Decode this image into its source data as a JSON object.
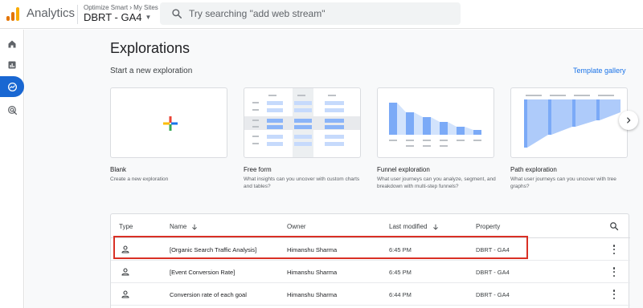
{
  "header": {
    "app_title": "Analytics",
    "breadcrumb": [
      "Optimize Smart",
      "My Sites"
    ],
    "breadcrumb_sep": "›",
    "property_name": "DBRT - GA4",
    "search_placeholder": "Try searching \"add web stream\""
  },
  "nav": {
    "items": [
      {
        "icon": "home-icon"
      },
      {
        "icon": "reports-icon"
      },
      {
        "icon": "explore-icon",
        "active": true
      },
      {
        "icon": "advertising-icon"
      }
    ],
    "accent_color": "#1967d2"
  },
  "main": {
    "title": "Explorations",
    "section_title": "Start a new exploration",
    "template_link": "Template gallery",
    "cards": [
      {
        "title": "Blank",
        "desc": "Create a new exploration",
        "icon": "plus-icon"
      },
      {
        "title": "Free form",
        "desc": "What insights can you uncover with custom charts and tables?"
      },
      {
        "title": "Funnel exploration",
        "desc": "What user journeys can you analyze, segment, and breakdown with multi-step funnels?"
      },
      {
        "title": "Path exploration",
        "desc": "What user journeys can you uncover with tree graphs?"
      }
    ]
  },
  "table": {
    "columns": {
      "type": "Type",
      "name": "Name",
      "owner": "Owner",
      "modified": "Last modified",
      "property": "Property"
    },
    "rows": [
      {
        "name": "[Organic Search Traffic Analysis]",
        "owner": "Himanshu Sharma",
        "modified": "6:45 PM",
        "property": "DBRT - GA4",
        "highlighted": true
      },
      {
        "name": "[Event Conversion Rate]",
        "owner": "Himanshu Sharma",
        "modified": "6:45 PM",
        "property": "DBRT - GA4"
      },
      {
        "name": "Conversion rate of each goal",
        "owner": "Himanshu Sharma",
        "modified": "6:44 PM",
        "property": "DBRT - GA4"
      }
    ],
    "highlight_color": "#d93025"
  }
}
